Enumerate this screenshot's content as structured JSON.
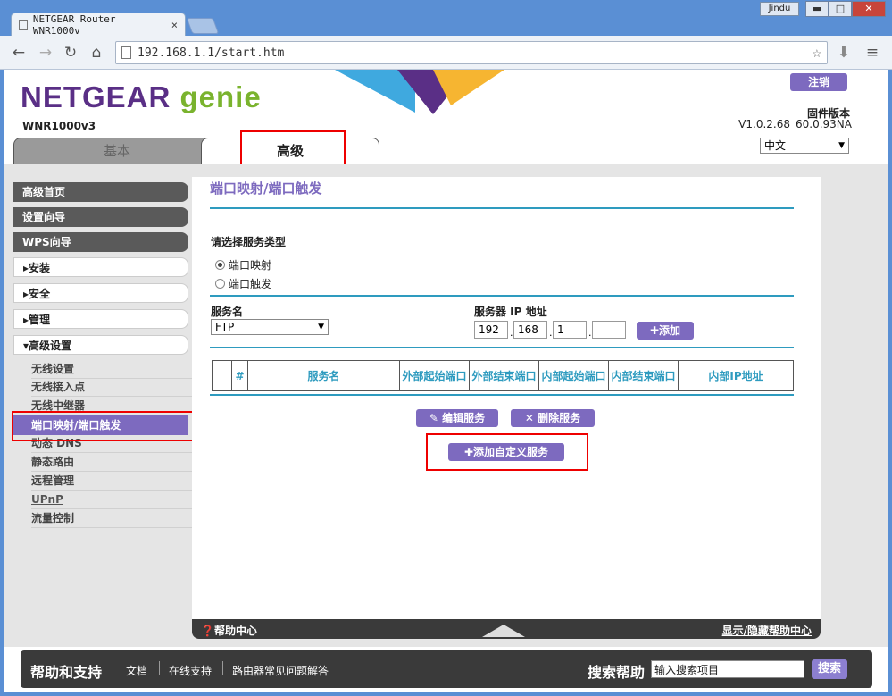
{
  "browser": {
    "tab_title": "NETGEAR Router WNR1000v",
    "tab_close": "×",
    "user": "Jindu",
    "url": "192.168.1.1/start.htm",
    "btn_min": "▬",
    "btn_max": "□",
    "btn_close": "✕"
  },
  "header": {
    "logo_netgear": "NETGEAR",
    "logo_genie": "genie",
    "model": "WNR1000v3",
    "logout": "注销",
    "firmware_label": "固件版本",
    "firmware_version": "V1.0.2.68_60.0.93NA",
    "language": "中文",
    "tab_basic": "基本",
    "tab_advanced": "高级"
  },
  "sidebar": {
    "advanced_home": "高级首页",
    "setup_wizard": "设置向导",
    "wps_wizard": "WPS向导",
    "setup": "▸安装",
    "security": "▸安全",
    "admin": "▸管理",
    "advanced_setup": "▾高级设置",
    "sub_items": [
      "无线设置",
      "无线接入点",
      "无线中继器",
      "端口映射/端口触发",
      "动态 DNS",
      "静态路由",
      "远程管理",
      "UPnP",
      "流量控制"
    ]
  },
  "main": {
    "title": "端口映射/端口触发",
    "service_type_label": "请选择服务类型",
    "radio_forwarding": "端口映射",
    "radio_triggering": "端口触发",
    "service_name_label": "服务名",
    "service_name_value": "FTP",
    "server_ip_label": "服务器 IP 地址",
    "ip": [
      "192",
      "168",
      "1",
      ""
    ],
    "add_button": "✚添加",
    "table_headers": [
      "",
      "#",
      "服务名",
      "外部起始端口",
      "外部结束端口",
      "内部起始端口",
      "内部结束端口",
      "内部IP地址"
    ],
    "edit_button": "✎ 编辑服务",
    "delete_button": "✕ 删除服务",
    "add_custom_button": "✚添加自定义服务"
  },
  "helpbar": {
    "help_center": "❓帮助中心",
    "toggle": "显示/隐藏帮助中心"
  },
  "footer": {
    "title": "帮助和支持",
    "links": [
      "文档",
      "在线支持",
      "路由器常见问题解答"
    ],
    "search_label": "搜索帮助",
    "search_placeholder": "输入搜索项目",
    "search_button": "搜索"
  },
  "colors": {
    "accent": "#7d6abf",
    "teal": "#2e9bbf",
    "highlight": "#e00000"
  }
}
